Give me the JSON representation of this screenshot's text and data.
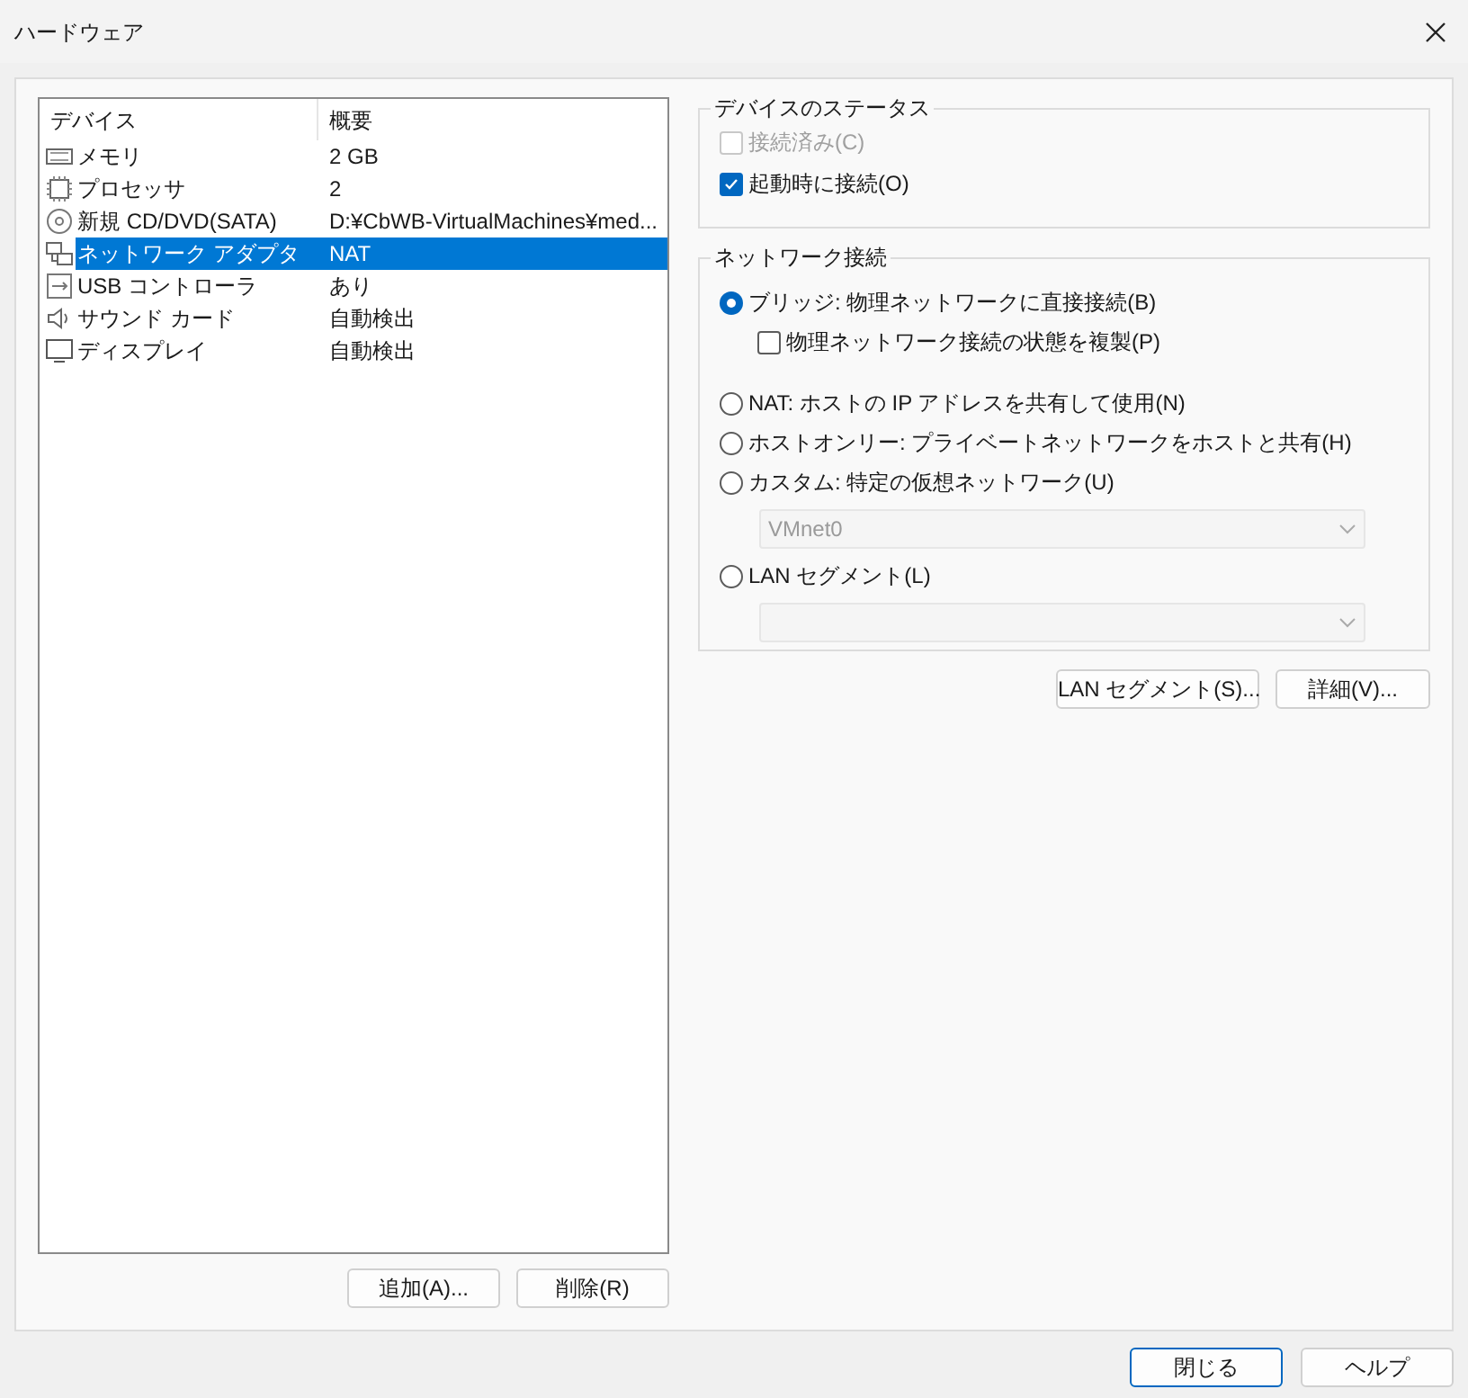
{
  "window": {
    "title": "ハードウェア"
  },
  "device_list": {
    "columns": [
      "デバイス",
      "概要"
    ],
    "rows": [
      {
        "kind": "memory",
        "device": "メモリ",
        "summary": "2 GB",
        "selected": false
      },
      {
        "kind": "processor",
        "device": "プロセッサ",
        "summary": "2",
        "selected": false
      },
      {
        "kind": "disc",
        "device": "新規 CD/DVD(SATA)",
        "summary": "D:¥CbWB-VirtualMachines¥med...",
        "selected": false
      },
      {
        "kind": "network",
        "device": "ネットワーク アダプタ",
        "summary": "NAT",
        "selected": true
      },
      {
        "kind": "usb",
        "device": "USB コントローラ",
        "summary": "あり",
        "selected": false
      },
      {
        "kind": "sound",
        "device": "サウンド カード",
        "summary": "自動検出",
        "selected": false
      },
      {
        "kind": "display",
        "device": "ディスプレイ",
        "summary": "自動検出",
        "selected": false
      }
    ]
  },
  "list_buttons": [
    "追加(A)...",
    "削除(R)"
  ],
  "device_status": {
    "title": "デバイスのステータス",
    "options": [
      {
        "label": "接続済み(C)",
        "checked": false,
        "disabled": true
      },
      {
        "label": "起動時に接続(O)",
        "checked": true,
        "disabled": false
      }
    ]
  },
  "network_connection": {
    "title": "ネットワーク接続",
    "options": [
      {
        "kind": "radio",
        "label": "ブリッジ: 物理ネットワークに直接接続(B)",
        "selected": true
      },
      {
        "kind": "checkbox",
        "label": "物理ネットワーク接続の状態を複製(P)",
        "checked": false
      },
      {
        "kind": "radio",
        "label": "NAT: ホストの IP アドレスを共有して使用(N)",
        "selected": false
      },
      {
        "kind": "radio",
        "label": "ホストオンリー: プライベートネットワークをホストと共有(H)",
        "selected": false
      },
      {
        "kind": "radio",
        "label": "カスタム: 特定の仮想ネットワーク(U)",
        "selected": false
      },
      {
        "kind": "dropdown",
        "value": "VMnet0",
        "disabled": true
      },
      {
        "kind": "radio",
        "label": "LAN セグメント(L)",
        "selected": false
      },
      {
        "kind": "dropdown",
        "disabled": true
      }
    ]
  },
  "network_buttons": [
    "LAN セグメント(S)...",
    "詳細(V)..."
  ],
  "dialog_buttons": [
    {
      "label": "閉じる",
      "default": true
    },
    {
      "label": "ヘルプ",
      "default": false
    }
  ]
}
